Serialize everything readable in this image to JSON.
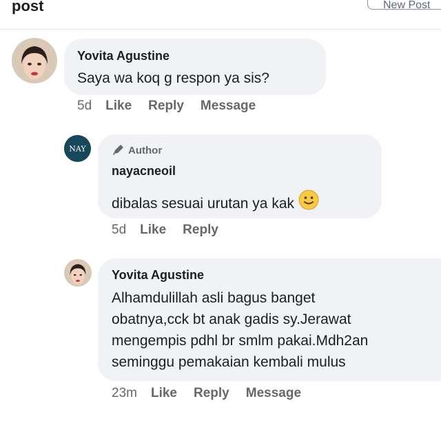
{
  "header": {
    "title": "post",
    "button_label": "New Post"
  },
  "comments": [
    {
      "author": "Yovita Agustine",
      "text": "Saya wa koq g respon ya sis?",
      "time": "5d",
      "actions": [
        "Like",
        "Reply",
        "Message"
      ]
    },
    {
      "badge": "Author",
      "author": "nayacneoil",
      "avatar_text": "NAY",
      "text": "dibalas sesuai urutan ya kak",
      "emoji": "slightly-smiling-face-icon",
      "time": "5d",
      "actions": [
        "Like",
        "Reply"
      ]
    },
    {
      "author": "Yovita Agustine",
      "text_lines": [
        "Alhamdulillah asli bagus banget",
        "obatnya,cck bt anak gadis sy.Jerawat",
        "mengempis pdhl br smlm pakai.Mdh2an",
        "seminggu pemakaian kembali mulus"
      ],
      "time": "23m",
      "actions": [
        "Like",
        "Reply",
        "Message"
      ]
    }
  ],
  "colors": {
    "bubble": "#f0f2f5",
    "secondary_text": "#65676b",
    "nay_avatar": "#17475a"
  }
}
